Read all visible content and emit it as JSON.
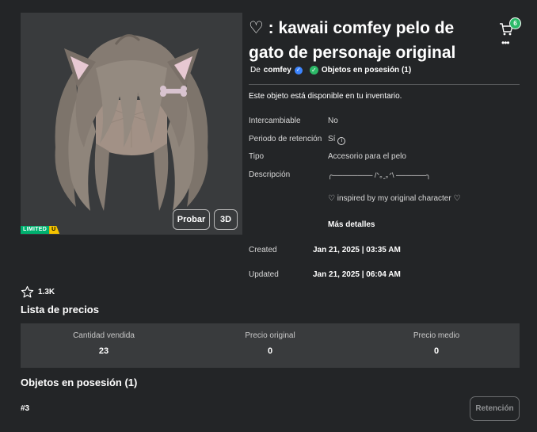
{
  "item": {
    "title": "♡ : kawaii comfey pelo de gato de personaje original",
    "creator_prefix": "De",
    "creator_name": "comfey",
    "owned_label": "Objetos en posesión (1)",
    "availability": "Este objeto está disponible en tu inventario."
  },
  "thumbnail": {
    "limited_label": "LIMITED",
    "limited_u": "U",
    "try_button": "Probar",
    "view3d_button": "3D"
  },
  "header": {
    "cart_count": "6"
  },
  "details": {
    "tradable_label": "Intercambiable",
    "tradable_value": "No",
    "hold_label": "Periodo de retención",
    "hold_value": "Sí",
    "type_label": "Tipo",
    "type_value": "Accesorio para el pelo",
    "description_label": "Descripción",
    "description_line1": "╭──────── /ᐠ｡ꞈ｡ᐟ\\ ──────╮",
    "description_line2": "♡ inspired by my original character ♡",
    "more_details": "Más detalles",
    "created_label": "Created",
    "created_value": "Jan 21, 2025 | 03:35 AM",
    "updated_label": "Updated",
    "updated_value": "Jan 21, 2025 | 06:04 AM"
  },
  "favorites": {
    "count": "1.3K"
  },
  "price_list": {
    "heading": "Lista de precios",
    "stats": [
      {
        "label": "Cantidad vendida",
        "value": "23"
      },
      {
        "label": "Precio original",
        "value": "0"
      },
      {
        "label": "Precio medio",
        "value": "0"
      }
    ]
  },
  "owned_section": {
    "heading": "Objetos en posesión (1)",
    "serial": "#3",
    "hold_button": "Retención"
  },
  "colors": {
    "background": "#232527",
    "panel": "#393b3d",
    "accent_green": "#2cb968",
    "verified_blue": "#3d85ff",
    "limited_yellow": "#f5c400"
  }
}
